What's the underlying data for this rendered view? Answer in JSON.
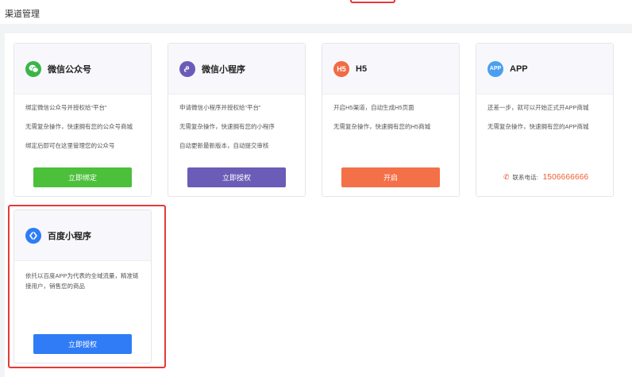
{
  "page": {
    "title": "渠道管理"
  },
  "cards": [
    {
      "name": "微信公众号",
      "icon": "wechat-icon",
      "icon_color": "#3bb54a",
      "lines": [
        "绑定微信公众号并授权给“平台”",
        "无需复杂操作，快速拥有您的公众号商城",
        "绑定后即可在这里管理您的公众号"
      ],
      "button": "立即绑定",
      "button_color": "#4cbf3b"
    },
    {
      "name": "微信小程序",
      "icon": "mini-program-icon",
      "icon_color": "#6a5cb7",
      "lines": [
        "申请微信小程序并授权给“平台”",
        "无需复杂操作，快速拥有您的小程序",
        "自动更新最新版本，自动提交审核"
      ],
      "button": "立即授权",
      "button_color": "#6a5cb7"
    },
    {
      "name": "H5",
      "icon": "h5-icon",
      "icon_glyph": "H5",
      "icon_color": "#ef6c45",
      "lines": [
        "开启H5渠道，自动生成H5页面",
        "无需复杂操作，快速拥有您的H5商城"
      ],
      "button": "开启",
      "button_color": "#f47048"
    },
    {
      "name": "APP",
      "icon": "app-icon",
      "icon_glyph": "APP",
      "icon_color": "#4a9ff0",
      "lines": [
        "还差一步，就可以开始正式开APP商城",
        "无需复杂操作，快速拥有您的APP商城"
      ],
      "contact_label": "联系电话:",
      "contact_phone": "1506666666"
    },
    {
      "name": "百度小程序",
      "icon": "baidu-icon",
      "icon_color": "#2f7cf6",
      "lines": [
        "依托以百度APP为代表的全域流量，精准链接用户，销售您的商品"
      ],
      "button": "立即授权",
      "button_color": "#2f7cf6"
    }
  ]
}
